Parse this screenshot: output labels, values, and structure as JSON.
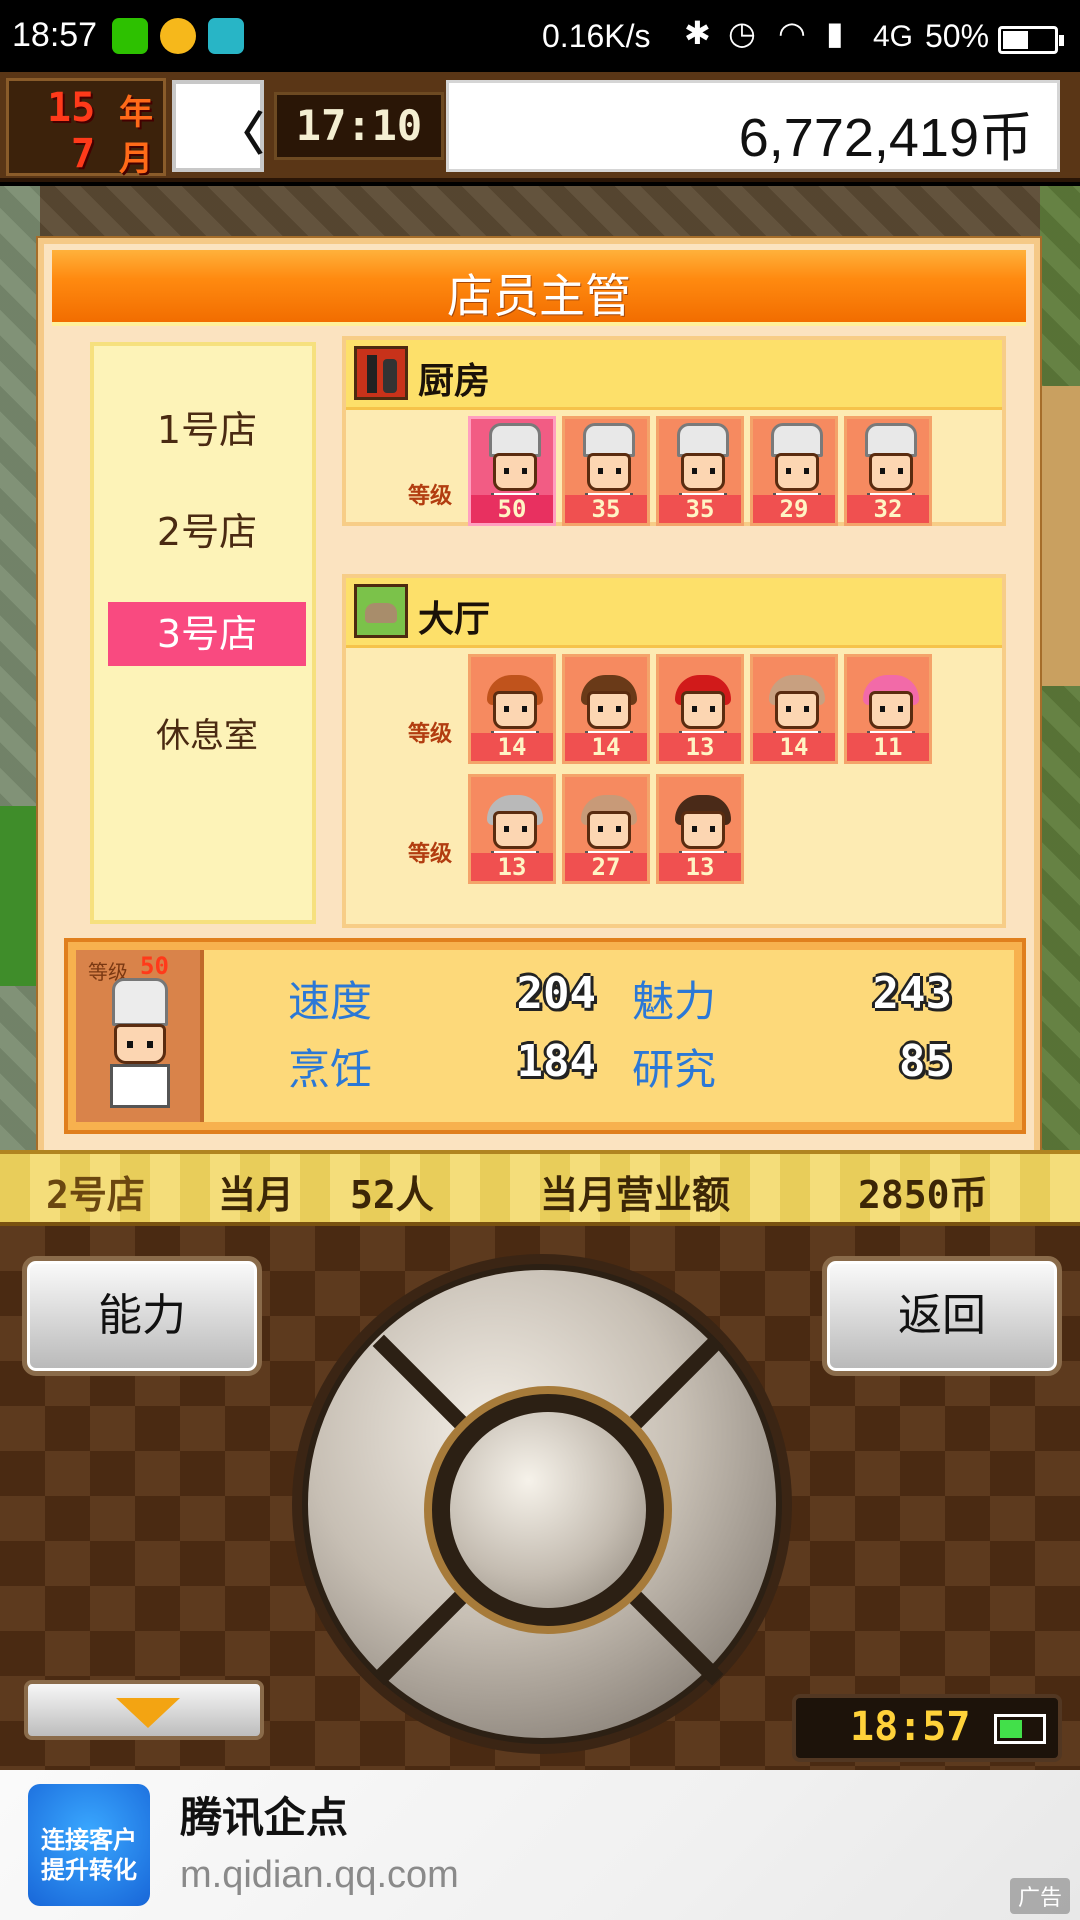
{
  "status_bar": {
    "time": "18:57",
    "net_speed": "0.16K/s",
    "bluetooth_glyph": "✱",
    "alarm_glyph": "◷",
    "wifi_glyph": "◠",
    "signal_glyph": "▮",
    "network": "4G",
    "battery_pct": "50%",
    "battery_level": 0.5,
    "app_icons": [
      "wechat-icon",
      "plus-icon",
      "scan-icon"
    ]
  },
  "top_bar": {
    "year_num": "15",
    "year_unit": "年",
    "month_num": "7",
    "month_unit": "月",
    "clock_hand": "〈",
    "game_time": "17:10",
    "money": "6,772,419币"
  },
  "dialog": {
    "title": "店员主管",
    "stores": [
      {
        "label": "1号店",
        "active": false
      },
      {
        "label": "2号店",
        "active": false
      },
      {
        "label": "3号店",
        "active": true
      },
      {
        "label": "休息室",
        "active": false
      }
    ],
    "grade_label": "等级",
    "kitchen": {
      "label": "厨房",
      "staff": [
        {
          "level": "50",
          "selected": true
        },
        {
          "level": "35",
          "selected": false
        },
        {
          "level": "35",
          "selected": false
        },
        {
          "level": "29",
          "selected": false
        },
        {
          "level": "32",
          "selected": false
        }
      ]
    },
    "hall": {
      "label": "大厅",
      "staff": [
        {
          "level": "14",
          "hair": "#c0531c"
        },
        {
          "level": "14",
          "hair": "#6a3a18"
        },
        {
          "level": "13",
          "hair": "#d11a1a"
        },
        {
          "level": "14",
          "hair": "#c8a080"
        },
        {
          "level": "11",
          "hair": "#f26aa8"
        },
        {
          "level": "13",
          "hair": "#b9b9b9"
        },
        {
          "level": "27",
          "hair": "#c89a78"
        },
        {
          "level": "13",
          "hair": "#4a2a18"
        }
      ]
    },
    "detail": {
      "grade_label": "等级",
      "grade_value": "50",
      "stats": [
        {
          "name": "速度",
          "value": "204"
        },
        {
          "name": "魅力",
          "value": "243"
        },
        {
          "name": "烹饪",
          "value": "184"
        },
        {
          "name": "研究",
          "value": "85"
        }
      ]
    }
  },
  "status_strip": {
    "store": "2号店",
    "month": "当月",
    "visitors": "52人",
    "revenue_label": "当月营业额",
    "revenue": "2850币"
  },
  "controls": {
    "ability_label": "能力",
    "back_label": "返回",
    "clock": "18:57",
    "battery_level": 0.55
  },
  "ad": {
    "logo_line1": "连接客户",
    "logo_line2": "提升转化",
    "title": "腾讯企点",
    "url": "m.qidian.qq.com",
    "tag": "广告"
  }
}
